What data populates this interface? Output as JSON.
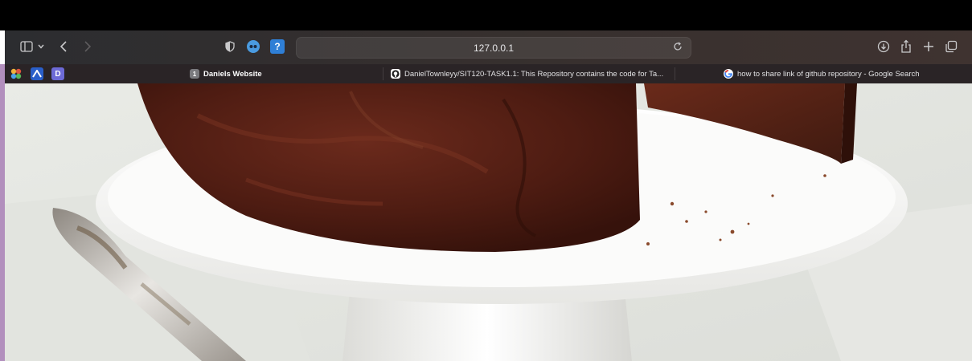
{
  "toolbar": {
    "sidebar_icon": "sidebar-icon",
    "chevron_icon": "chevron-down-icon",
    "back_icon": "back-arrow-icon",
    "forward_icon": "forward-arrow-icon",
    "privacy_icon": "shield-icon",
    "extension_icons": [
      "github-copilot-icon",
      "help-icon"
    ],
    "address": "127.0.0.1",
    "reload_icon": "reload-icon",
    "download_icon": "download-icon",
    "share_icon": "share-icon",
    "new_tab_icon": "plus-icon",
    "tab_overview_icon": "tabs-overview-icon"
  },
  "pinned_tabs": [
    {
      "name": "app-favicon-1",
      "color": "#e5a23a"
    },
    {
      "name": "app-favicon-2",
      "color": "#3b6fd8"
    },
    {
      "name": "app-favicon-3",
      "label": "D",
      "color": "#6d6ad6"
    }
  ],
  "tabs": [
    {
      "icon_text": "1",
      "title": "Daniels Website",
      "active": true
    },
    {
      "icon": "github-icon",
      "title": "DanielTownleyy/SIT120-TASK1.1: This Repository contains the code for Ta..."
    },
    {
      "icon": "google-icon",
      "title": "how to share link of github repository - Google Search"
    }
  ],
  "page": {
    "image_subject": "chocolate-cake-on-stand",
    "colors": {
      "accent_strip": "#b28fbd",
      "plate": "#f7f7f5",
      "cake": "#5a2318"
    }
  }
}
